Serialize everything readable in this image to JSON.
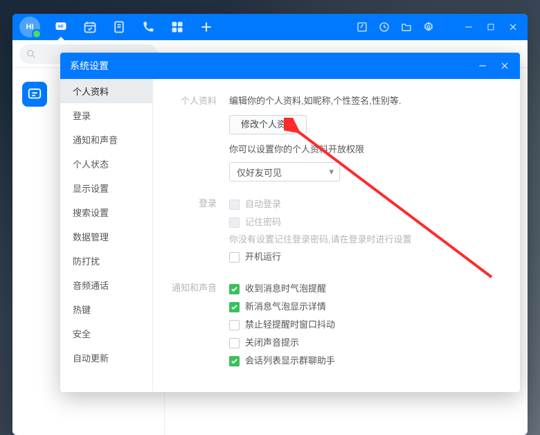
{
  "dialog": {
    "title": "系统设置",
    "nav": [
      "个人资料",
      "登录",
      "通知和声音",
      "个人状态",
      "显示设置",
      "搜索设置",
      "数据管理",
      "防打扰",
      "音频通话",
      "热键",
      "安全",
      "自动更新"
    ],
    "section_personal": {
      "label": "个人资料",
      "desc": "编辑你的个人资料,如昵称,个性签名,性别等.",
      "btn": "修改个人资料",
      "perm_hint": "你可以设置你的个人资料开放权限",
      "perm_value": "仅好友可见"
    },
    "section_login": {
      "label": "登录",
      "auto": "自动登录",
      "remember": "记住密码",
      "hint": "你没有设置记住登录密码,请在登录时进行设置",
      "boot": "开机运行"
    },
    "section_notify": {
      "label": "通知和声音",
      "items": [
        {
          "text": "收到消息时气泡提醒",
          "on": true
        },
        {
          "text": "新消息气泡显示详情",
          "on": true
        },
        {
          "text": "禁止轻提醒时窗口抖动",
          "on": false
        },
        {
          "text": "关闭声音提示",
          "on": false
        },
        {
          "text": "会话列表显示群聊助手",
          "on": true
        }
      ]
    }
  },
  "avatar": "HI"
}
